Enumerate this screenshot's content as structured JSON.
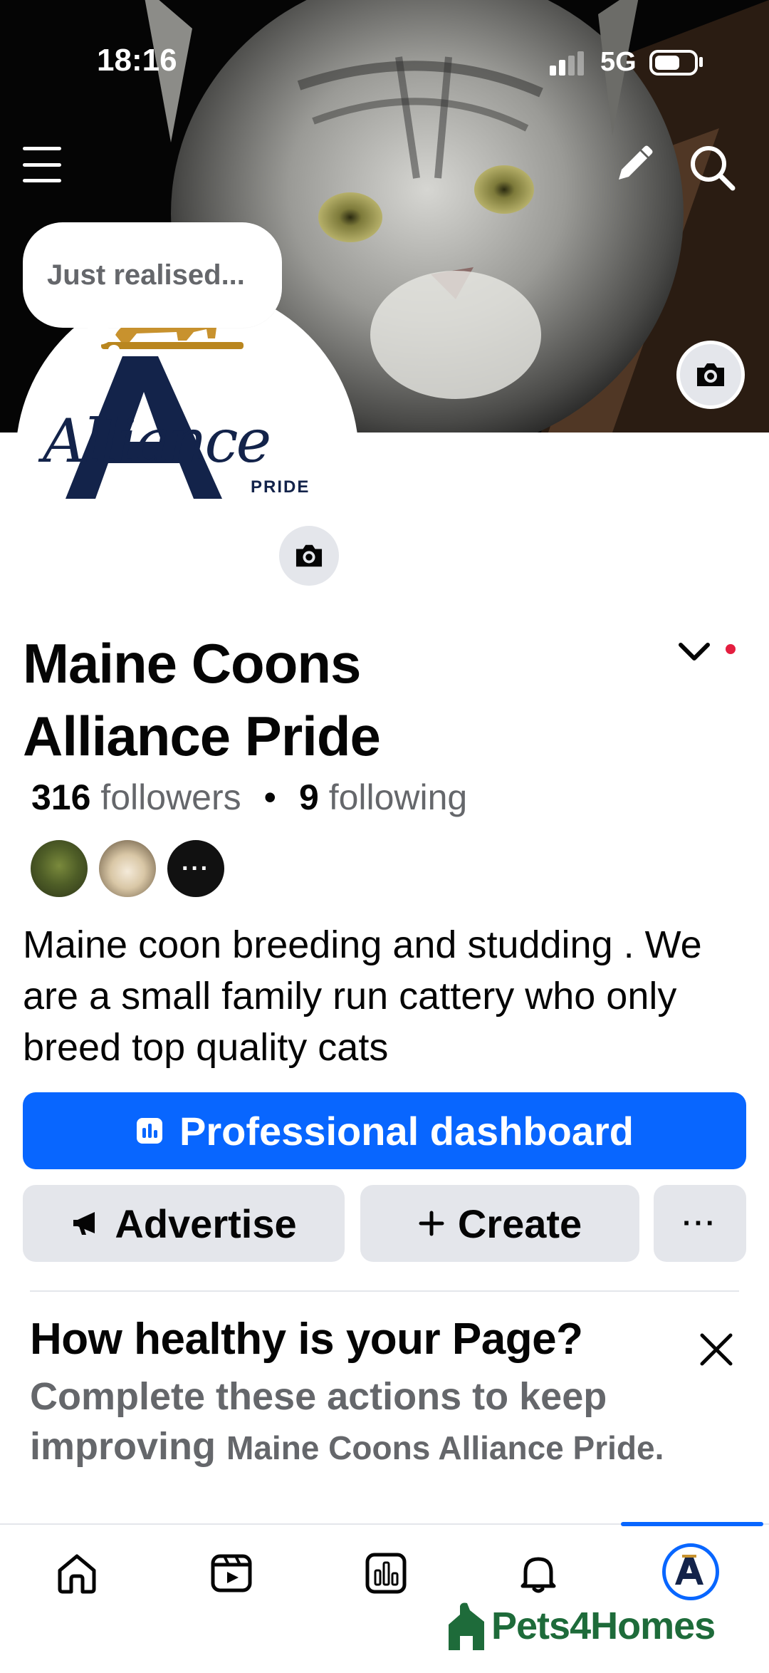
{
  "status_bar": {
    "time": "18:16",
    "network": "5G"
  },
  "profile": {
    "bubble_note": "Just realised...",
    "logo_text": "Alliance",
    "logo_subtext": "PRIDE",
    "name_line1": "Maine Coons",
    "name_line2": "Alliance Pride",
    "followers_count": "316",
    "followers_label": "followers",
    "following_count": "9",
    "following_label": "following",
    "more_followers": "···",
    "bio": "Maine coon breeding and studding . We are a small family run cattery who only breed top quality cats"
  },
  "actions": {
    "dashboard_label": "Professional dashboard",
    "advertise_label": "Advertise",
    "create_label": "Create",
    "more_label": "···"
  },
  "page_health": {
    "title": "How healthy is your Page?",
    "desc_prefix": "Complete these actions to keep improving",
    "page_name": "Maine Coons Alliance Pride",
    "desc_suffix": "."
  },
  "bottom_nav": {
    "items": [
      "home-icon",
      "video-icon",
      "dashboard-icon",
      "bell-icon",
      "profile-avatar"
    ],
    "active": "profile-avatar",
    "accent": "#0866ff"
  },
  "watermark": {
    "text": "Pets4Homes",
    "color": "#1e6b3a"
  },
  "colors": {
    "primary": "#0866ff",
    "secondary_bg": "#e4e6eb",
    "muted_text": "#65676b",
    "notification": "#e41e3f"
  }
}
